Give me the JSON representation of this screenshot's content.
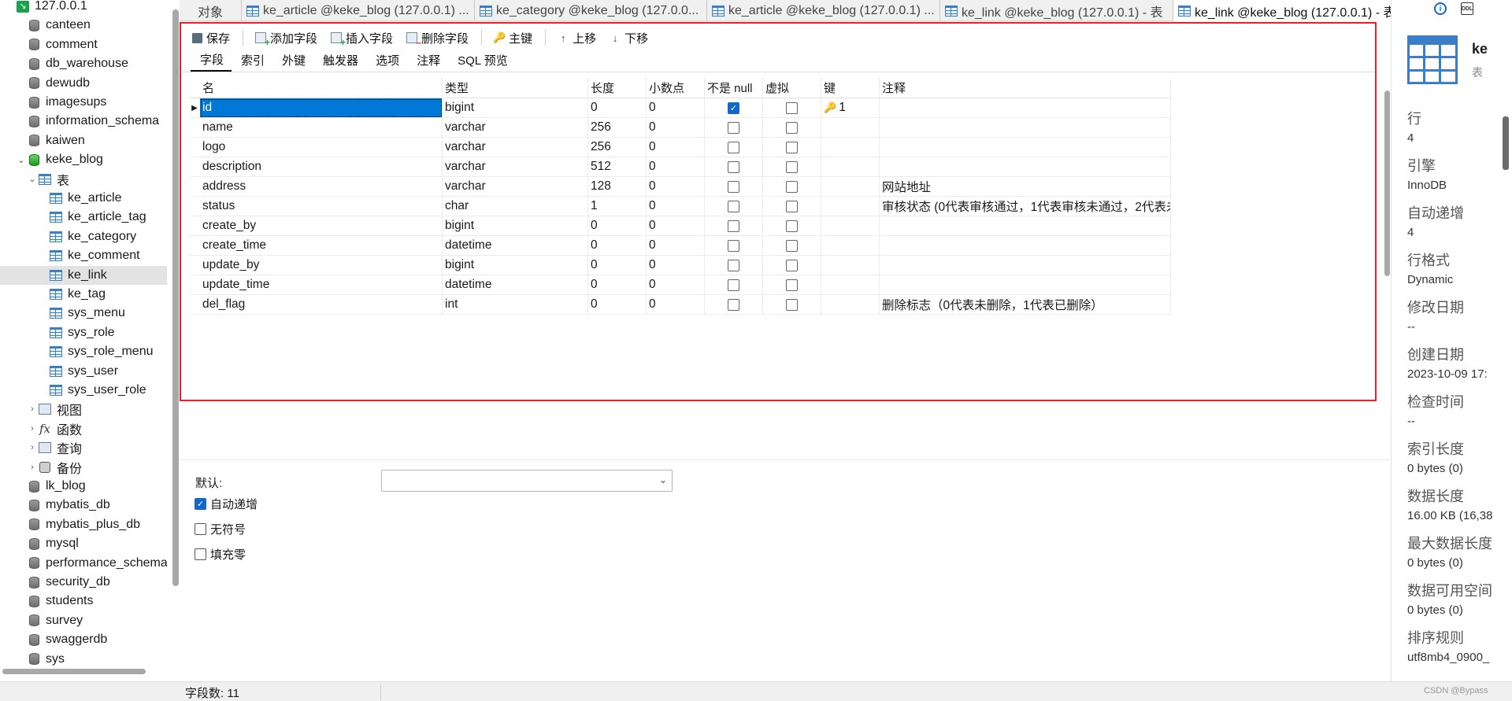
{
  "sidebar": {
    "items": [
      {
        "label": "127.0.0.1",
        "type": "conn",
        "chev": "",
        "indent": 0
      },
      {
        "label": "canteen",
        "type": "db",
        "chev": "",
        "indent": 1
      },
      {
        "label": "comment",
        "type": "db",
        "chev": "",
        "indent": 1
      },
      {
        "label": "db_warehouse",
        "type": "db",
        "chev": "",
        "indent": 1
      },
      {
        "label": "dewudb",
        "type": "db",
        "chev": "",
        "indent": 1
      },
      {
        "label": "imagesups",
        "type": "db",
        "chev": "",
        "indent": 1
      },
      {
        "label": "information_schema",
        "type": "db",
        "chev": "",
        "indent": 1
      },
      {
        "label": "kaiwen",
        "type": "db",
        "chev": "",
        "indent": 1
      },
      {
        "label": "keke_blog",
        "type": "db-active",
        "chev": "⌄",
        "indent": 1
      },
      {
        "label": "表",
        "type": "tables",
        "chev": "⌄",
        "indent": 2
      },
      {
        "label": "ke_article",
        "type": "table",
        "chev": "",
        "indent": 3
      },
      {
        "label": "ke_article_tag",
        "type": "table",
        "chev": "",
        "indent": 3
      },
      {
        "label": "ke_category",
        "type": "table",
        "chev": "",
        "indent": 3
      },
      {
        "label": "ke_comment",
        "type": "table",
        "chev": "",
        "indent": 3
      },
      {
        "label": "ke_link",
        "type": "table",
        "chev": "",
        "indent": 3,
        "selected": true
      },
      {
        "label": "ke_tag",
        "type": "table",
        "chev": "",
        "indent": 3
      },
      {
        "label": "sys_menu",
        "type": "table",
        "chev": "",
        "indent": 3
      },
      {
        "label": "sys_role",
        "type": "table",
        "chev": "",
        "indent": 3
      },
      {
        "label": "sys_role_menu",
        "type": "table",
        "chev": "",
        "indent": 3
      },
      {
        "label": "sys_user",
        "type": "table",
        "chev": "",
        "indent": 3
      },
      {
        "label": "sys_user_role",
        "type": "table",
        "chev": "",
        "indent": 3
      },
      {
        "label": "视图",
        "type": "view",
        "chev": "›",
        "indent": 2
      },
      {
        "label": "函数",
        "type": "func",
        "chev": "›",
        "indent": 2
      },
      {
        "label": "查询",
        "type": "query",
        "chev": "›",
        "indent": 2
      },
      {
        "label": "备份",
        "type": "backup",
        "chev": "›",
        "indent": 2
      },
      {
        "label": "lk_blog",
        "type": "db",
        "chev": "",
        "indent": 1
      },
      {
        "label": "mybatis_db",
        "type": "db",
        "chev": "",
        "indent": 1
      },
      {
        "label": "mybatis_plus_db",
        "type": "db",
        "chev": "",
        "indent": 1
      },
      {
        "label": "mysql",
        "type": "db",
        "chev": "",
        "indent": 1
      },
      {
        "label": "performance_schema",
        "type": "db",
        "chev": "",
        "indent": 1
      },
      {
        "label": "security_db",
        "type": "db",
        "chev": "",
        "indent": 1
      },
      {
        "label": "students",
        "type": "db",
        "chev": "",
        "indent": 1
      },
      {
        "label": "survey",
        "type": "db",
        "chev": "",
        "indent": 1
      },
      {
        "label": "swaggerdb",
        "type": "db",
        "chev": "",
        "indent": 1
      },
      {
        "label": "sys",
        "type": "db",
        "chev": "",
        "indent": 1
      }
    ]
  },
  "tabs": [
    {
      "label": "对象",
      "icon": false
    },
    {
      "label": "ke_article @keke_blog (127.0.0.1) ...",
      "icon": true
    },
    {
      "label": "ke_category @keke_blog (127.0.0...",
      "icon": true
    },
    {
      "label": "ke_article @keke_blog (127.0.0.1) ...",
      "icon": true
    },
    {
      "label": "ke_link @keke_blog (127.0.0.1) - 表",
      "icon": true
    },
    {
      "label": "ke_link @keke_blog (127.0.0.1) - 表",
      "icon": true,
      "active": true
    }
  ],
  "toolbar": {
    "save": "保存",
    "add_field": "添加字段",
    "insert_field": "插入字段",
    "delete_field": "删除字段",
    "primary_key": "主键",
    "move_up": "上移",
    "move_down": "下移"
  },
  "subtabs": [
    "字段",
    "索引",
    "外键",
    "触发器",
    "选项",
    "注释",
    "SQL 预览"
  ],
  "columns_header": {
    "name": "名",
    "type": "类型",
    "length": "长度",
    "decimals": "小数点",
    "not_null": "不是 null",
    "virtual": "虚拟",
    "key": "键",
    "comment": "注释"
  },
  "fields": [
    {
      "name": "id",
      "type": "bigint",
      "length": "0",
      "decimals": "0",
      "not_null": true,
      "virtual": false,
      "key": "1",
      "comment": ""
    },
    {
      "name": "name",
      "type": "varchar",
      "length": "256",
      "decimals": "0",
      "not_null": false,
      "virtual": false,
      "key": "",
      "comment": ""
    },
    {
      "name": "logo",
      "type": "varchar",
      "length": "256",
      "decimals": "0",
      "not_null": false,
      "virtual": false,
      "key": "",
      "comment": ""
    },
    {
      "name": "description",
      "type": "varchar",
      "length": "512",
      "decimals": "0",
      "not_null": false,
      "virtual": false,
      "key": "",
      "comment": ""
    },
    {
      "name": "address",
      "type": "varchar",
      "length": "128",
      "decimals": "0",
      "not_null": false,
      "virtual": false,
      "key": "",
      "comment": "网站地址"
    },
    {
      "name": "status",
      "type": "char",
      "length": "1",
      "decimals": "0",
      "not_null": false,
      "virtual": false,
      "key": "",
      "comment": "审核状态 (0代表审核通过，1代表审核未通过，2代表未"
    },
    {
      "name": "create_by",
      "type": "bigint",
      "length": "0",
      "decimals": "0",
      "not_null": false,
      "virtual": false,
      "key": "",
      "comment": ""
    },
    {
      "name": "create_time",
      "type": "datetime",
      "length": "0",
      "decimals": "0",
      "not_null": false,
      "virtual": false,
      "key": "",
      "comment": ""
    },
    {
      "name": "update_by",
      "type": "bigint",
      "length": "0",
      "decimals": "0",
      "not_null": false,
      "virtual": false,
      "key": "",
      "comment": ""
    },
    {
      "name": "update_time",
      "type": "datetime",
      "length": "0",
      "decimals": "0",
      "not_null": false,
      "virtual": false,
      "key": "",
      "comment": ""
    },
    {
      "name": "del_flag",
      "type": "int",
      "length": "0",
      "decimals": "0",
      "not_null": false,
      "virtual": false,
      "key": "",
      "comment": "删除标志（0代表未删除，1代表已删除）"
    }
  ],
  "props": {
    "default_label": "默认:",
    "auto_increment": "自动递增",
    "unsigned": "无符号",
    "zerofill": "填充零"
  },
  "status": {
    "field_count": "字段数: 11",
    "watermark": "CSDN @Bypass"
  },
  "info": {
    "name": "ke",
    "kind": "表",
    "rows_label": "行",
    "rows": "4",
    "engine_label": "引擎",
    "engine": "InnoDB",
    "auto_inc_label": "自动递增",
    "auto_inc": "4",
    "row_format_label": "行格式",
    "row_format": "Dynamic",
    "modified_label": "修改日期",
    "modified": "--",
    "created_label": "创建日期",
    "created": "2023-10-09 17:",
    "checked_label": "检查时间",
    "checked": "--",
    "index_len_label": "索引长度",
    "index_len": "0 bytes (0)",
    "data_len_label": "数据长度",
    "data_len": "16.00 KB (16,38",
    "max_data_len_label": "最大数据长度",
    "max_data_len": "0 bytes (0)",
    "free_label": "数据可用空间",
    "free": "0 bytes (0)",
    "collation_label": "排序规则",
    "collation": "utf8mb4_0900_"
  },
  "colors": {
    "accent": "#0078d7",
    "frame_border": "#e0232e",
    "db_active": "#1f9a1f"
  }
}
